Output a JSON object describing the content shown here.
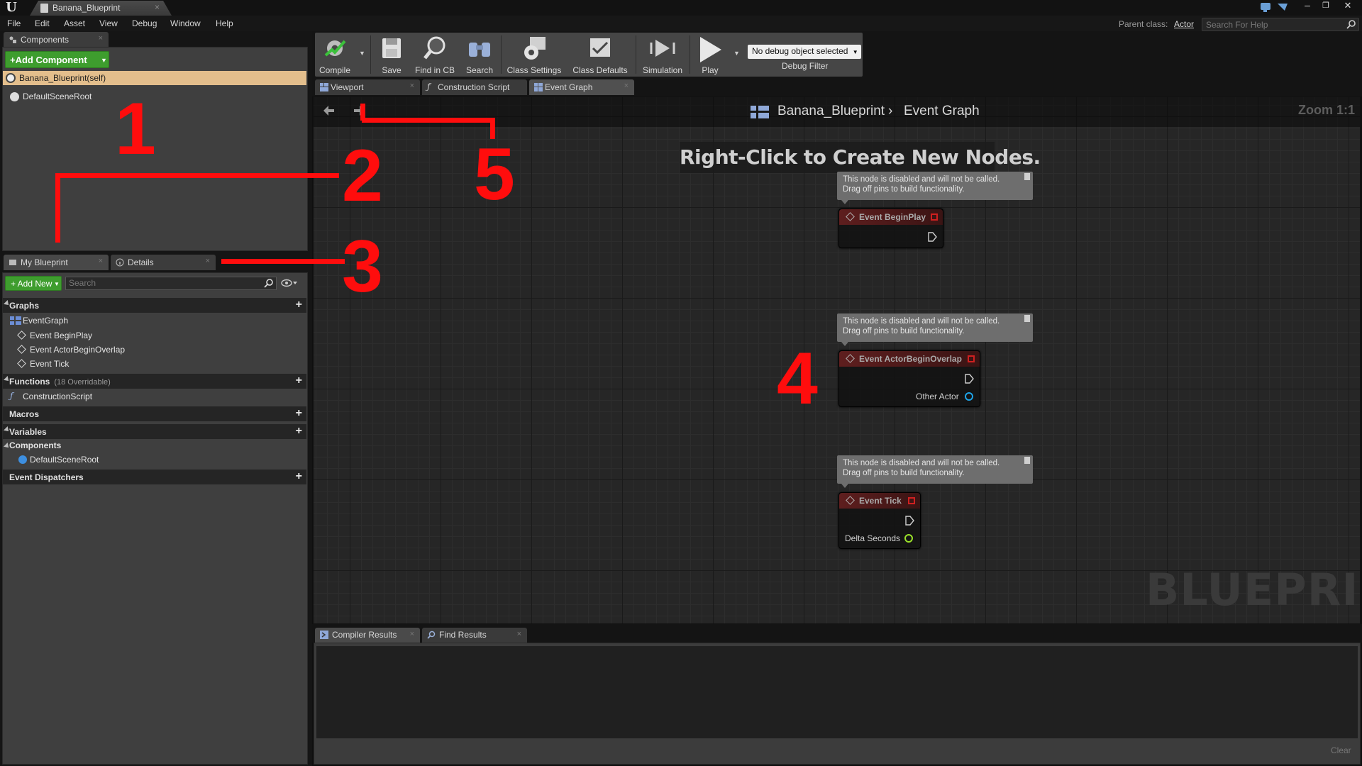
{
  "window": {
    "tab_title": "Banana_Blueprint"
  },
  "menu": {
    "items": [
      "File",
      "Edit",
      "Asset",
      "View",
      "Debug",
      "Window",
      "Help"
    ],
    "parent_class_label": "Parent class:",
    "parent_class_value": "Actor",
    "help_search_placeholder": "Search For Help"
  },
  "components_panel": {
    "tab_label": "Components",
    "add_button": "+Add Component",
    "self_item": "Banana_Blueprint(self)",
    "root_item": "DefaultSceneRoot"
  },
  "my_blueprint_panel": {
    "tab_label": "My Blueprint",
    "details_tab_label": "Details",
    "add_new_button": "+ Add New",
    "search_placeholder": "Search",
    "sections": {
      "graphs": "Graphs",
      "event_graph": "EventGraph",
      "graph_events": [
        "Event BeginPlay",
        "Event ActorBeginOverlap",
        "Event Tick"
      ],
      "functions": "Functions",
      "functions_note": "(18 Overridable)",
      "construction_script": "ConstructionScript",
      "macros": "Macros",
      "variables": "Variables",
      "components": "Components",
      "components_item": "DefaultSceneRoot",
      "event_dispatchers": "Event Dispatchers"
    }
  },
  "toolbar": {
    "buttons": [
      "Compile",
      "Save",
      "Find in CB",
      "Search",
      "Class Settings",
      "Class Defaults",
      "Simulation",
      "Play"
    ],
    "debug_select": "No debug object selected",
    "debug_label": "Debug Filter"
  },
  "graph_tabs": [
    "Viewport",
    "Construction Script",
    "Event Graph"
  ],
  "graph": {
    "breadcrumb_root": "Banana_Blueprint",
    "breadcrumb_leaf": "Event Graph",
    "zoom": "Zoom 1:1",
    "hint": "Right-Click to Create New Nodes.",
    "watermark": "BLUEPRINT",
    "disabled_comment_line1": "This node is disabled and will not be called.",
    "disabled_comment_line2": "Drag off pins to build functionality.",
    "nodes": [
      {
        "title": "Event BeginPlay"
      },
      {
        "title": "Event ActorBeginOverlap",
        "pin": "Other Actor"
      },
      {
        "title": "Event Tick",
        "pin": "Delta Seconds"
      }
    ]
  },
  "bottom_panel": {
    "tabs": [
      "Compiler Results",
      "Find Results"
    ],
    "clear_button": "Clear"
  },
  "annotations": [
    "1",
    "2",
    "3",
    "4",
    "5"
  ],
  "colors": {
    "annotation_red": "#ff0d0d",
    "add_button_green": "#3e9d2e",
    "selected_row": "#e3be8c",
    "event_node_header": "#5e1e1e"
  }
}
